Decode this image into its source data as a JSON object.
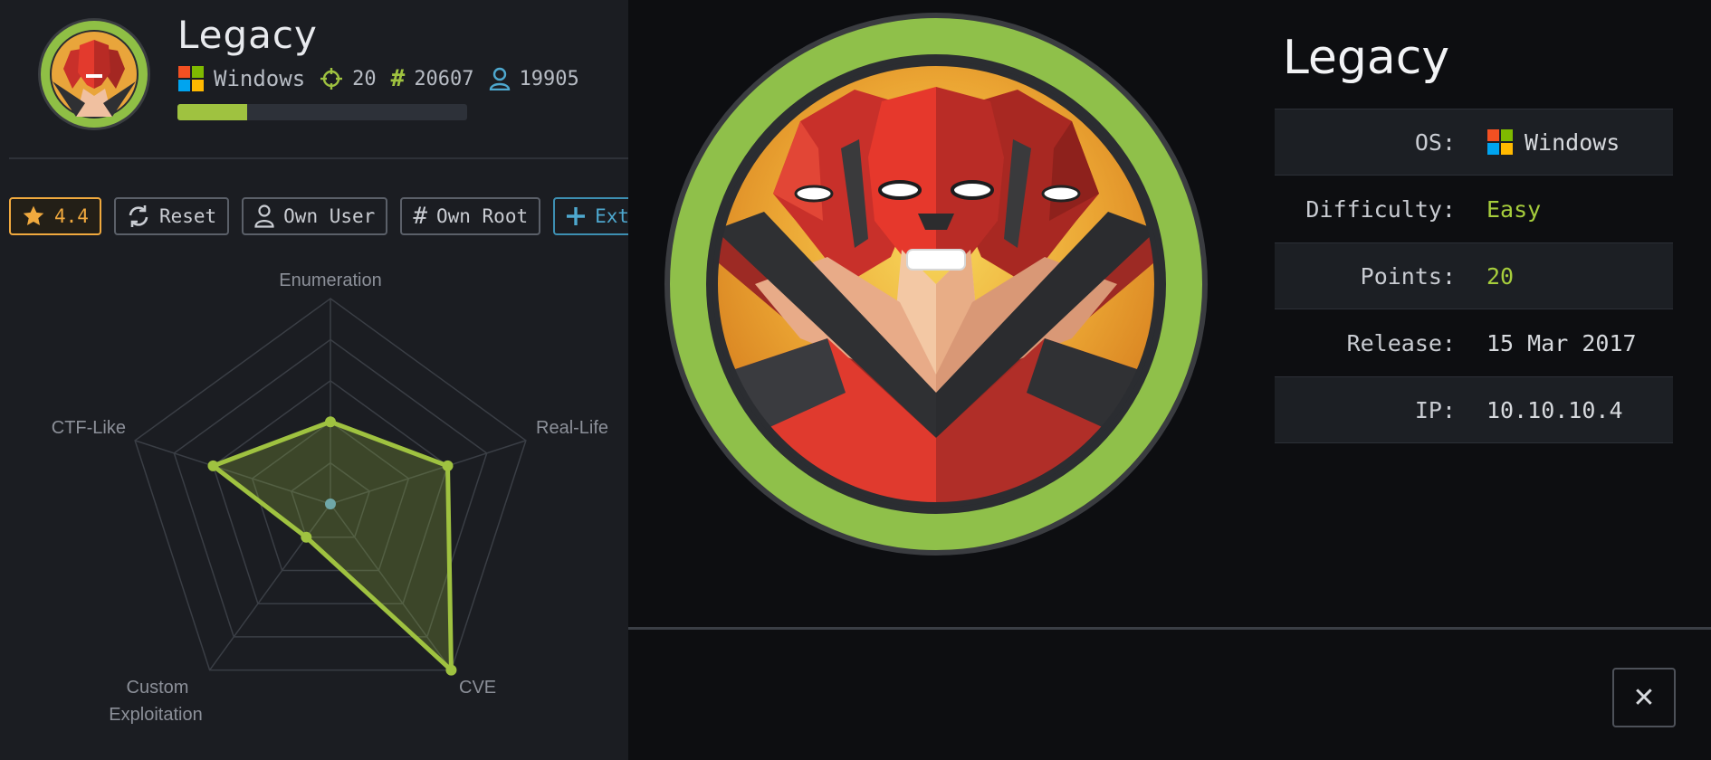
{
  "machine": {
    "name": "Legacy",
    "os": "Windows",
    "points": "20",
    "system_owns": "20607",
    "user_owns": "19905",
    "progress_fraction": 0.24
  },
  "buttons": {
    "rating": "4.4",
    "reset": "Reset",
    "own_user": "Own User",
    "own_root": "Own Root",
    "extend": "Exten"
  },
  "chart_data": {
    "type": "radar",
    "axes": [
      "Enumeration",
      "Real-Life",
      "CVE",
      "Custom Exploitation",
      "CTF-Like"
    ],
    "series": [
      {
        "values": [
          4,
          6,
          10,
          2,
          6
        ]
      }
    ],
    "range": [
      0,
      10
    ],
    "grid": true,
    "colors": {
      "series": "#9fc240",
      "grid": "#3a3e45",
      "label": "#8c9099"
    }
  },
  "modal": {
    "title": "Legacy",
    "rows": [
      {
        "label": "OS:",
        "value": "Windows",
        "icon": "windows-icon"
      },
      {
        "label": "Difficulty:",
        "value": "Easy"
      },
      {
        "label": "Points:",
        "value": "20"
      },
      {
        "label": "Release:",
        "value": "15 Mar 2017"
      },
      {
        "label": "IP:",
        "value": "10.10.10.4"
      }
    ],
    "close": "✕"
  },
  "colors": {
    "accent_green": "#9fc240",
    "rating": "#f0a93e",
    "extend": "#4ea8cf"
  }
}
